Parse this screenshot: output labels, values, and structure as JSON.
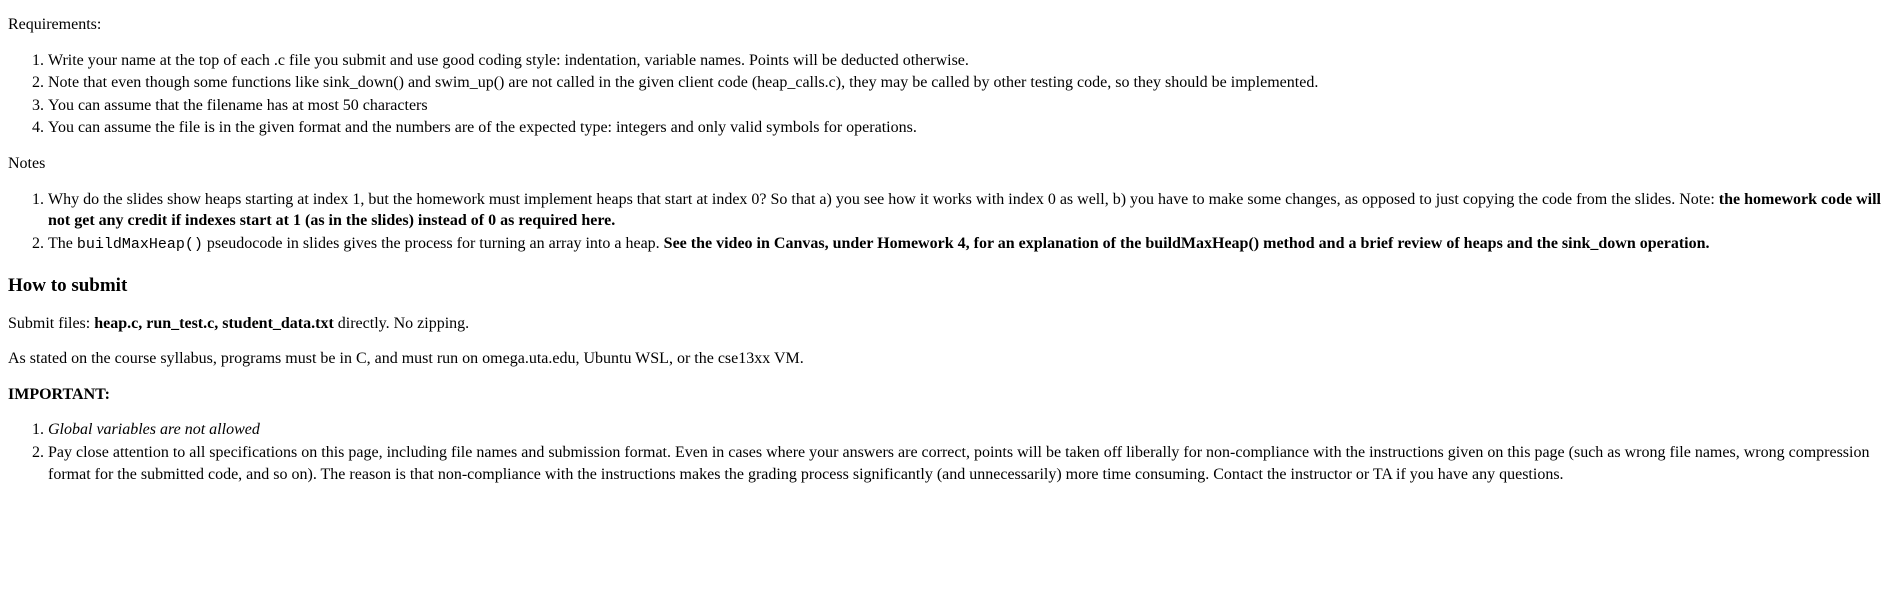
{
  "requirementsLabel": "Requirements:",
  "req1": "Write your name at the top of each .c file you submit and use good coding style: indentation, variable names. Points will be deducted otherwise.",
  "req2": "Note that even though some functions like sink_down() and swim_up() are not called in the given client code (heap_calls.c), they may be called by other testing code, so they should be implemented.",
  "req3": "You can assume that the filename has at most 50 characters",
  "req4": "You can assume the file is in the given format and the numbers are of the expected type: integers and only valid symbols for operations.",
  "notesLabel": "Notes",
  "note1_a": "Why do the slides show heaps starting at index 1, but the homework must implement heaps that start at index 0? So that a) you see how it works with index 0 as well, b) you have to make some changes, as opposed to just copying the code from the slides. Note: ",
  "note1_b": "the homework code will not get any credit if indexes start at 1 (as in the slides) instead of 0 as required here.",
  "note2_a": "The ",
  "note2_code": "buildMaxHeap()",
  "note2_b": " pseudocode in slides gives the process for turning an array into a heap. ",
  "note2_c": "See the video in Canvas, under Homework 4, for an explanation of the buildMaxHeap() method and a brief review of heaps and the sink_down operation.",
  "howToSubmit": "How to submit",
  "submit_a": "Submit files: ",
  "submit_files": "heap.c, run_test.c, student_data.txt",
  "submit_b": " directly. No zipping.",
  "syllabus": "As stated on the course syllabus, programs must be in C, and must run on omega.uta.edu, Ubuntu WSL, or the cse13xx VM.",
  "importantLabel": "IMPORTANT:",
  "imp1": "Global variables are not allowed",
  "imp2": "Pay close attention to all specifications on this page, including file names and submission format. Even in cases where your answers are correct, points will be taken off liberally for non-compliance with the instructions given on this page (such as wrong file names, wrong compression format for the submitted code, and so on). The reason is that non-compliance with the instructions makes the grading process significantly (and unnecessarily) more time consuming. Contact the instructor or TA if you have any questions."
}
